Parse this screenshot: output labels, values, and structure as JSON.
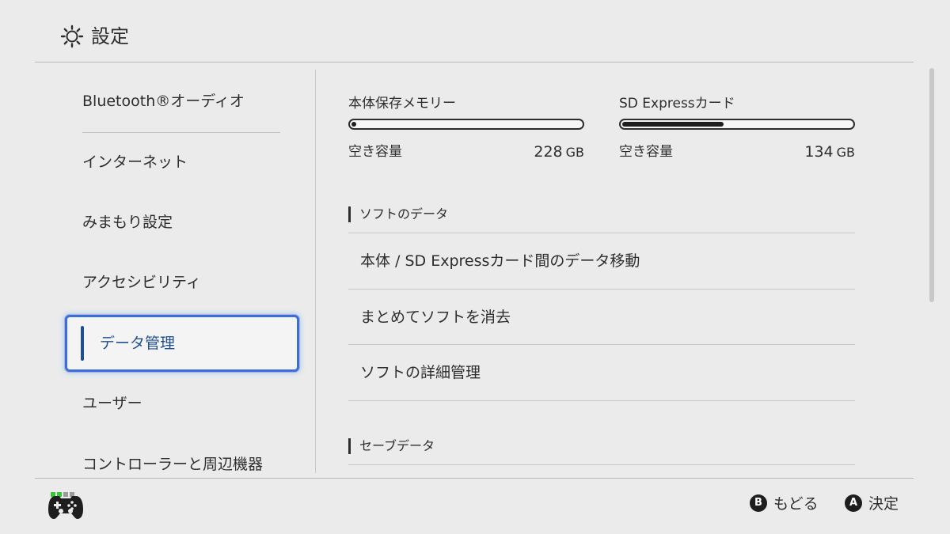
{
  "header": {
    "title": "設定",
    "icon": "gear-icon"
  },
  "sidebar": {
    "items": [
      {
        "label": "Bluetooth®オーディオ"
      },
      {
        "label": "インターネット"
      },
      {
        "label": "みまもり設定"
      },
      {
        "label": "アクセシビリティ"
      },
      {
        "label": "データ管理",
        "selected": true
      },
      {
        "label": "ユーザー"
      },
      {
        "label": "コントローラーと周辺機器"
      }
    ]
  },
  "storage": {
    "system": {
      "name": "本体保存メモリー",
      "free_label": "空き容量",
      "free_value": "228",
      "unit": "GB",
      "used_fraction": 0.02
    },
    "sd": {
      "name": "SD Expressカード",
      "free_label": "空き容量",
      "free_value": "134",
      "unit": "GB",
      "used_fraction": 0.44
    }
  },
  "sections": {
    "software": {
      "heading": "ソフトのデータ",
      "items": [
        "本体 / SD Expressカード間のデータ移動",
        "まとめてソフトを消去",
        "ソフトの詳細管理"
      ]
    },
    "save": {
      "heading": "セーブデータ"
    }
  },
  "footer": {
    "back": {
      "key": "B",
      "label": "もどる"
    },
    "confirm": {
      "key": "A",
      "label": "決定"
    },
    "controller": {
      "icon": "gamepad-icon",
      "player_leds_on": 2,
      "player_leds_total": 4
    }
  },
  "colors": {
    "background": "#ebebeb",
    "selected_text": "#1f4f8f",
    "selected_border": "#3a6fd6",
    "led_on": "#38c538",
    "led_off": "#9a9a9a"
  }
}
